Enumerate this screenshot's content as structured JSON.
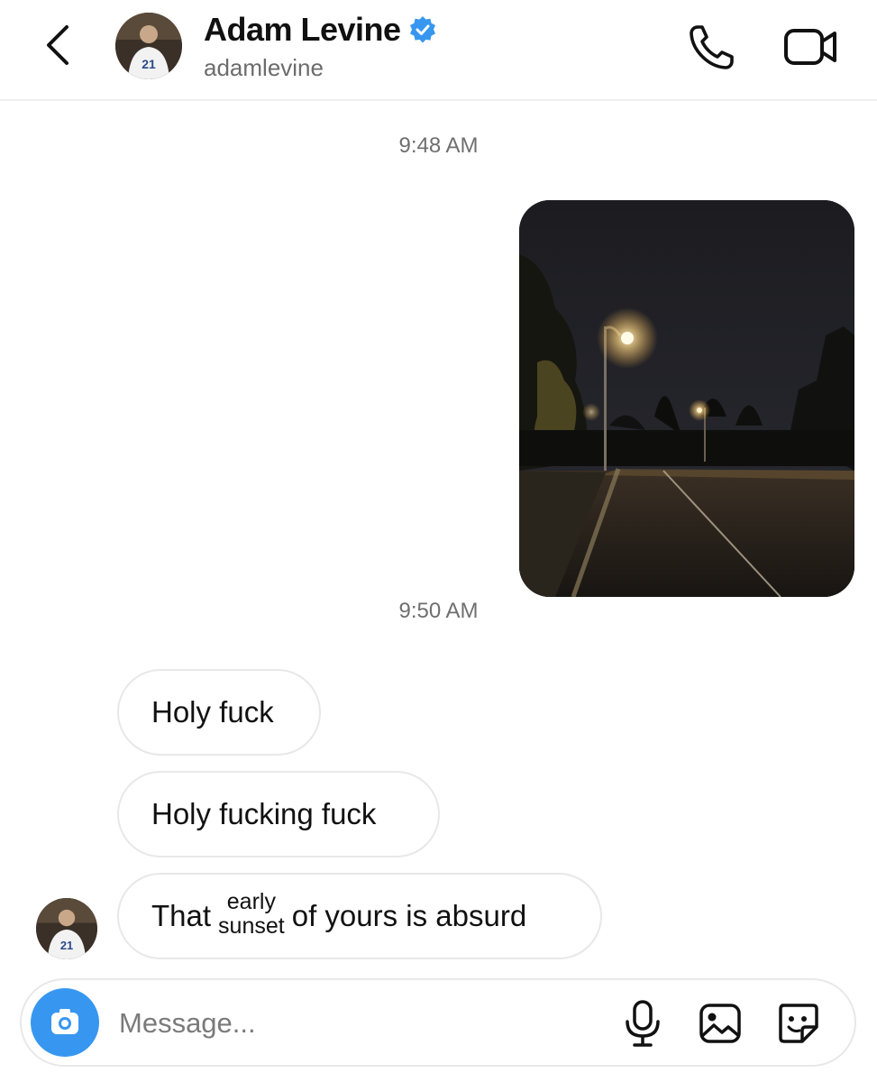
{
  "header": {
    "name": "Adam Levine",
    "username": "adamlevine",
    "verified": true,
    "accent_color": "#3797f0"
  },
  "thread": {
    "timestamp_1": "9:48 AM",
    "timestamp_2": "9:50 AM",
    "messages": [
      {
        "text": "Holy fuck"
      },
      {
        "text": "Holy fucking fuck"
      },
      {
        "prefix": "That",
        "overlay_top": "early",
        "overlay_bottom": "sunset",
        "suffix": "of yours is absurd"
      }
    ]
  },
  "composer": {
    "placeholder": "Message..."
  },
  "icons": {
    "back": "chevron-left-icon",
    "verified": "verified-badge-icon",
    "call": "phone-icon",
    "video": "video-camera-icon",
    "camera": "camera-icon",
    "mic": "microphone-icon",
    "gallery": "image-icon",
    "sticker": "sticker-icon"
  }
}
